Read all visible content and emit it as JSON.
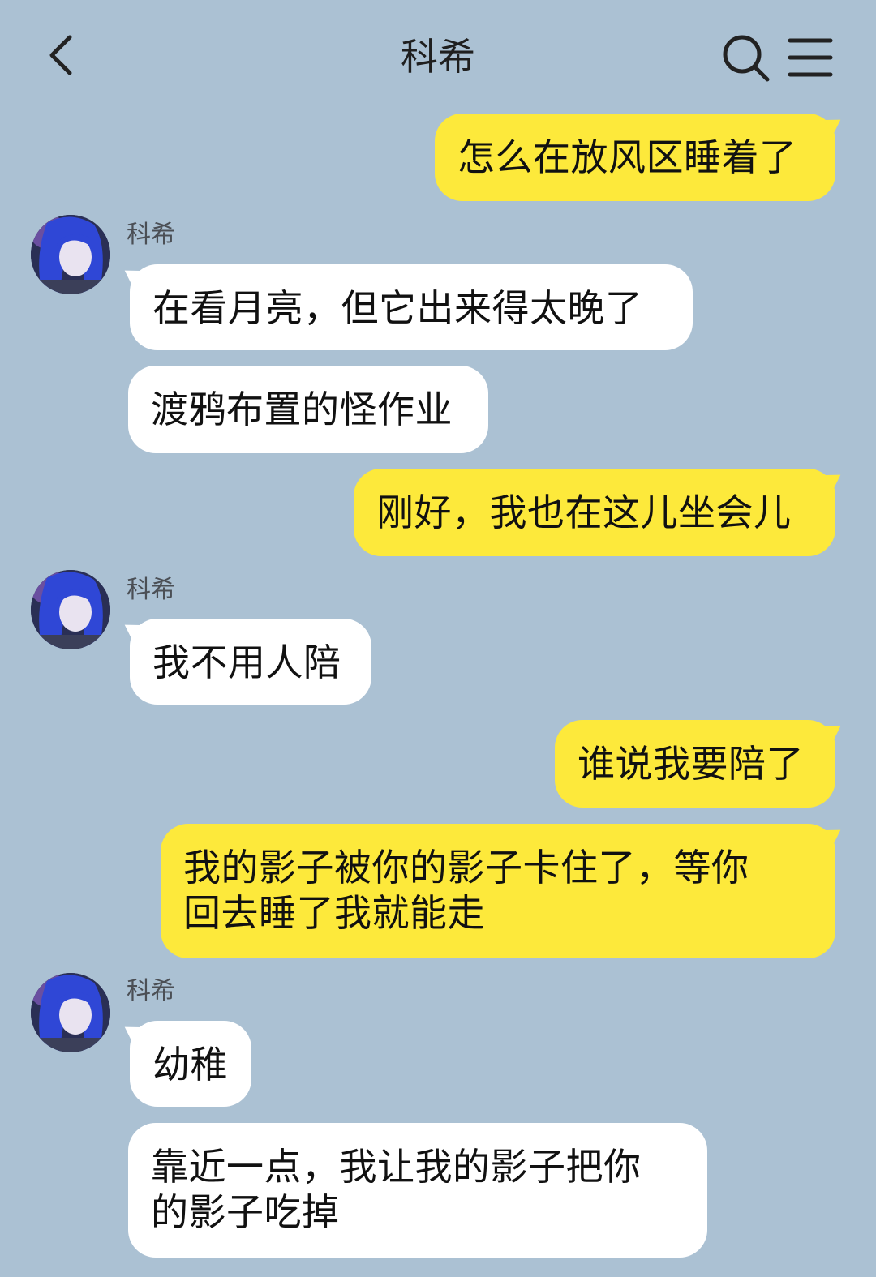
{
  "header": {
    "title": "科希",
    "icons": {
      "back": "chevron-left-icon",
      "search": "search-icon",
      "menu": "hamburger-menu-icon"
    }
  },
  "colors": {
    "background": "#abc1d3",
    "my_bubble": "#fde93b",
    "their_bubble": "#ffffff"
  },
  "messages": [
    {
      "from": "me",
      "text": "怎么在放风区睡着了"
    },
    {
      "from": "them",
      "sender": "科希",
      "text": "在看月亮，但它出来得太晚了"
    },
    {
      "from": "them",
      "text": "渡鸦布置的怪作业"
    },
    {
      "from": "me",
      "text": "刚好，我也在这儿坐会儿"
    },
    {
      "from": "them",
      "sender": "科希",
      "text": "我不用人陪"
    },
    {
      "from": "me",
      "text": "谁说我要陪了"
    },
    {
      "from": "me",
      "text": "我的影子被你的影子卡住了，等你\n回去睡了我就能走"
    },
    {
      "from": "them",
      "sender": "科希",
      "text": "幼稚"
    },
    {
      "from": "them",
      "text": "靠近一点，我让我的影子把你\n的影子吃掉"
    }
  ]
}
